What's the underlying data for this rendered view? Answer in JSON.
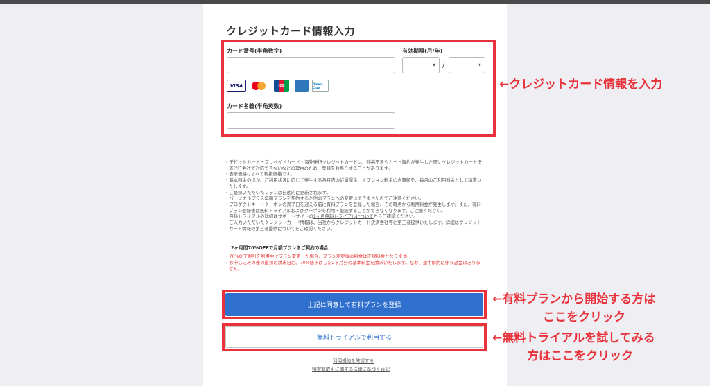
{
  "form": {
    "title": "クレジットカード情報入力",
    "card_number_label": "カード番号(半角数字)",
    "card_number_value": "",
    "expiry_label": "有効期限(月/年)",
    "expiry_month_value": "",
    "expiry_year_value": "",
    "expiry_separator": "/",
    "card_name_label": "カード名義(半角英数)",
    "card_name_value": "",
    "brands": [
      "VISA",
      "Mastercard",
      "JCB",
      "AMERICAN EXPRESS",
      "Diners Club"
    ]
  },
  "notes": [
    "・デビットカード・プリペイドカード・海外発行クレジットカードは、残高不足やカード解約が発生した際にクレジットカード決済代行会社で対応できないなどの理由のため、登録をお断りすることがあります。",
    "・表示価格はすべて税抜価格です。",
    "・基本料金のほか、ご利用状況に応じて発生する各月内の従量課金、オプション料金の合算額を、毎月のご利用料金として請求いたします。",
    "・ご登録いただいたプランは自動的に更新されます。",
    "・パーソナルプラス年額プランを契約すると他のプランへの変更はできませんのでご注意ください。",
    "・プロダクトキー・クーポンの満了日を迎える前に有料プランを登録した場合、その時点から利用料金が発生します。また、有料プラン登録後は無料トライアルおよびクーポンを利用・継続することができなくなります。ご注意ください。"
  ],
  "note_trial": {
    "prefix": "・無料トライアルの詳細はサポートサイトの",
    "link": "1ヶ月無料トライアルについて",
    "suffix": "からご確認ください。"
  },
  "note_third_party": {
    "text": "・ご入力いただいたクレジットカード情報は、当社からクレジットカード決済会社等に第三者提供いたします。詳細は",
    "link": "クレジットカード情報の第三者提供について",
    "suffix": "をご確認ください。"
  },
  "campaign": {
    "heading": "2ヶ月間70%OFFで月額プランをご契約の場合",
    "notes": [
      "・70%OFF割引を利用中にプラン変更した場合、プラン変更後の料金は正規料金となります。",
      "・お申し込みの後の最初の請求日に、70%値下げした2ヶ月分の基本料金を請求いたします。なお、途中解約に伴う返金はありません。"
    ]
  },
  "buttons": {
    "paid_label": "上記に同意して有料プランを登録",
    "trial_label": "無料トライアルで利用する"
  },
  "footer": {
    "terms_link": "利用規約を確認する",
    "law_link": "特定商取引に関する法律に基づく表記"
  },
  "annotations": {
    "form": "←クレジットカード情報を入力",
    "paid_line1": "←有料プランから開始する方は",
    "paid_line2": "ここをクリック",
    "trial_line1": "←無料トライアルを試してみる",
    "trial_line2": "方はここをクリック"
  },
  "colors": {
    "accent_red": "#e8323c",
    "primary_blue": "#2f6fcd"
  }
}
